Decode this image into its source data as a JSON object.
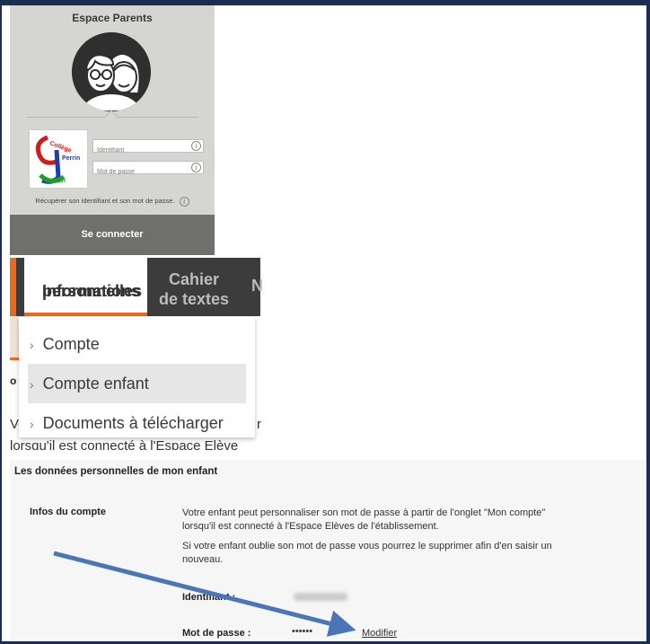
{
  "login": {
    "title": "Espace Parents",
    "username_placeholder": "Identifiant",
    "password_placeholder": "Mot de passe",
    "recover_text": "Récupérer son identifiant et son mot de passe.",
    "connect_label": "Se connecter",
    "info_glyph": "i",
    "logo_text": {
      "line1": "Collège",
      "line2": "Perrin",
      "line3": "Jean"
    }
  },
  "nav": {
    "active_tab": {
      "line1": "Informations",
      "line2": "personnelles"
    },
    "next_tab": {
      "line1": "Cahier",
      "line2": "de textes"
    },
    "next_tab_partial": "N"
  },
  "menu": {
    "items": [
      {
        "label": "Compte"
      },
      {
        "label": "Compte enfant"
      },
      {
        "label": "Documents à télécharger"
      }
    ]
  },
  "background_fragments": {
    "so": "o",
    "vo": "Vo",
    "right_r": "r",
    "line": "lorsqu'il est connecté à l'Espace Elève"
  },
  "details": {
    "section_title": "Les données personnelles de mon enfant",
    "account_label": "Infos du compte",
    "paragraph1_line1": "Votre enfant peut personnaliser son mot de passe à partir de l'onglet \"Mon compte\"",
    "paragraph1_line2": "lorsqu'il est connecté à l'Espace Elèves de l'établissement.",
    "paragraph2_line1": "Si votre enfant oublie son mot de passe vous pourrez le supprimer afin d'en saisir un",
    "paragraph2_line2": "nouveau.",
    "identifier_label": "Identifiant :",
    "password_label": "Mot de passe :",
    "password_value": "••••••",
    "modify_label": "Modifier"
  },
  "colors": {
    "accent": "#e86a1c",
    "nav_dark": "#3c3c3c",
    "login_bg": "#d5d5d1",
    "arrow": "#4a76b8"
  }
}
